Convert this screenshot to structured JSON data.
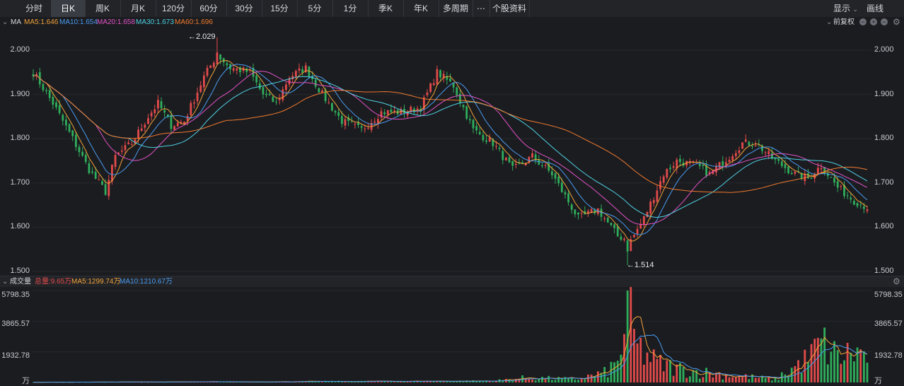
{
  "toolbar": {
    "tabs": [
      "分时",
      "日K",
      "周K",
      "月K",
      "120分",
      "60分",
      "30分",
      "15分",
      "5分",
      "1分",
      "季K",
      "年K",
      "多周期",
      "⋯",
      "个股资料"
    ],
    "active": "日K",
    "display_label": "显示",
    "draw_label": "画线"
  },
  "ma_legend": {
    "label": "MA",
    "ma5": "MA5:1.646",
    "ma10": "MA10:1.654",
    "ma20": "MA20:1.658",
    "ma30": "MA30:1.673",
    "ma60": "MA60:1.696",
    "adjust_label": "前复权"
  },
  "price_axis": {
    "ticks": [
      "2.000",
      "1.900",
      "1.800",
      "1.700",
      "1.600",
      "1.500"
    ],
    "min": 1.5,
    "max": 2.0
  },
  "annotations": {
    "high": "←2.029",
    "low": "←1.514"
  },
  "volume": {
    "label": "成交量",
    "total": "总量:9.65万",
    "ma5": "MA5:1299.74万",
    "ma10": "MA10:1210.67万",
    "ticks": [
      "5798.35",
      "3865.57",
      "1932.78"
    ],
    "unit": "万"
  },
  "colors": {
    "up": "#e34b4b",
    "down": "#2fae5b",
    "ma5": "#f2a33a",
    "ma10": "#4a9cf0",
    "ma20": "#e253c6",
    "ma30": "#4fd2e4",
    "ma60": "#f07a2e"
  },
  "chart_data": {
    "type": "candlestick",
    "price_key_points": [
      [
        0,
        1.95
      ],
      [
        6,
        1.88
      ],
      [
        12,
        1.8
      ],
      [
        17,
        1.73
      ],
      [
        22,
        1.68
      ],
      [
        25,
        1.76
      ],
      [
        30,
        1.79
      ],
      [
        35,
        1.85
      ],
      [
        38,
        1.88
      ],
      [
        42,
        1.83
      ],
      [
        46,
        1.84
      ],
      [
        52,
        1.94
      ],
      [
        56,
        1.99
      ],
      [
        60,
        1.96
      ],
      [
        66,
        1.95
      ],
      [
        70,
        1.9
      ],
      [
        74,
        1.88
      ],
      [
        78,
        1.94
      ],
      [
        83,
        1.96
      ],
      [
        88,
        1.9
      ],
      [
        94,
        1.84
      ],
      [
        100,
        1.82
      ],
      [
        106,
        1.86
      ],
      [
        112,
        1.86
      ],
      [
        118,
        1.87
      ],
      [
        123,
        1.95
      ],
      [
        128,
        1.92
      ],
      [
        134,
        1.82
      ],
      [
        140,
        1.79
      ],
      [
        146,
        1.73
      ],
      [
        152,
        1.76
      ],
      [
        158,
        1.72
      ],
      [
        166,
        1.62
      ],
      [
        172,
        1.64
      ],
      [
        178,
        1.58
      ],
      [
        182,
        1.57
      ],
      [
        186,
        1.62
      ],
      [
        192,
        1.72
      ],
      [
        196,
        1.75
      ],
      [
        202,
        1.74
      ],
      [
        206,
        1.72
      ],
      [
        212,
        1.76
      ],
      [
        216,
        1.79
      ],
      [
        220,
        1.79
      ],
      [
        226,
        1.75
      ],
      [
        232,
        1.72
      ],
      [
        236,
        1.71
      ],
      [
        240,
        1.74
      ],
      [
        245,
        1.69
      ],
      [
        250,
        1.66
      ],
      [
        254,
        1.645
      ]
    ],
    "volume_key_points": [
      [
        0,
        20
      ],
      [
        60,
        40
      ],
      [
        140,
        90
      ],
      [
        150,
        300
      ],
      [
        165,
        200
      ],
      [
        174,
        600
      ],
      [
        178,
        1200
      ],
      [
        181,
        4500
      ],
      [
        184,
        2200
      ],
      [
        190,
        1200
      ],
      [
        198,
        800
      ],
      [
        210,
        500
      ],
      [
        226,
        200
      ],
      [
        236,
        1500
      ],
      [
        240,
        2500
      ],
      [
        245,
        1600
      ],
      [
        250,
        1900
      ],
      [
        254,
        1700
      ]
    ],
    "volume_max": 5798.35
  }
}
